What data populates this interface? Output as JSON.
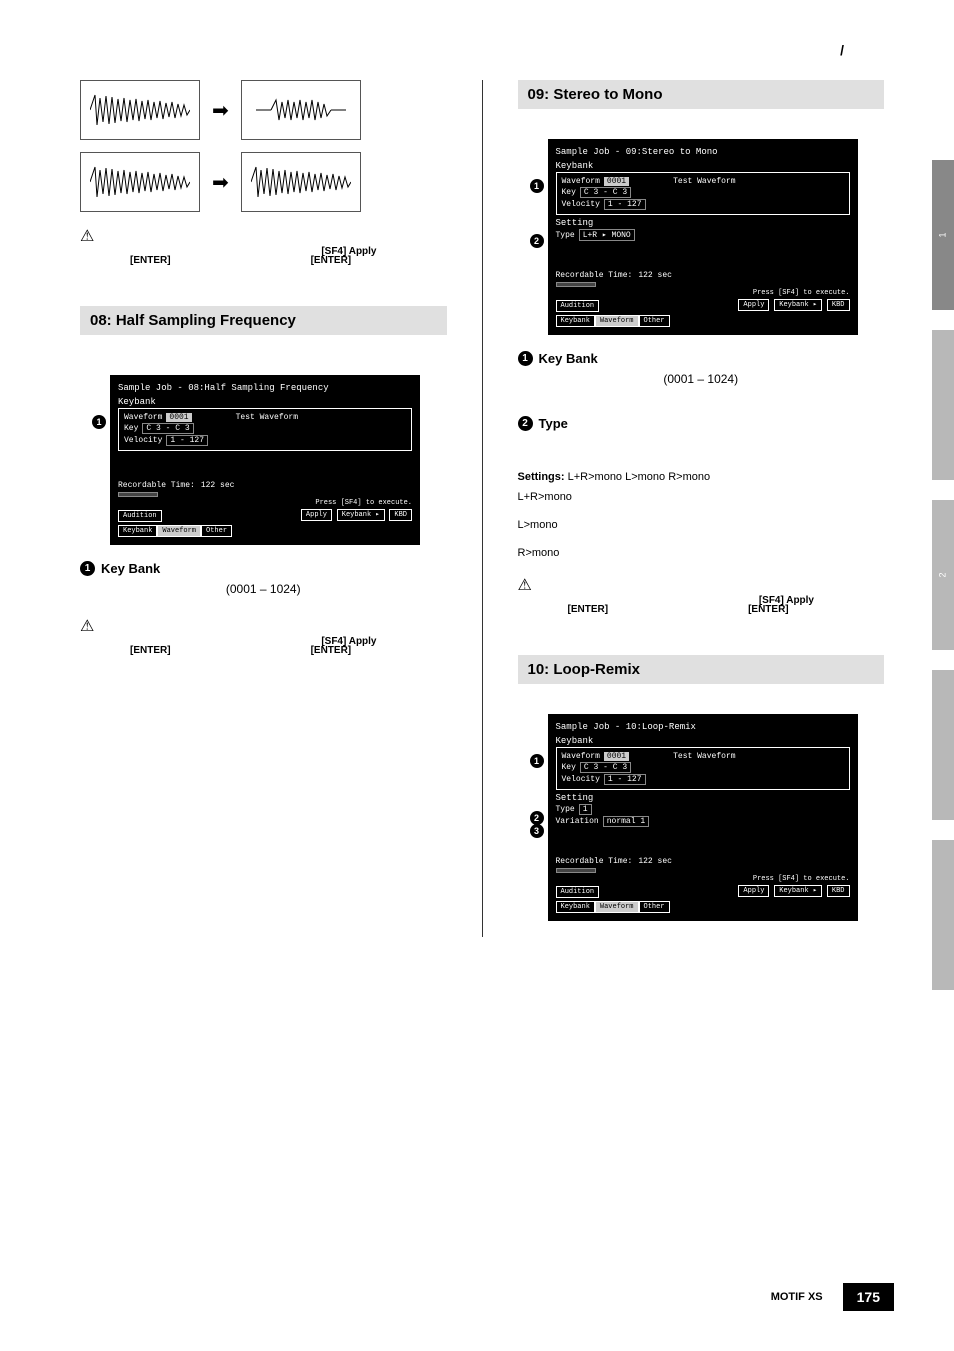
{
  "slash": "/",
  "sections": {
    "s08": {
      "title": "08: Half Sampling Frequency"
    },
    "s09": {
      "title": "09: Stereo to Mono"
    },
    "s10": {
      "title": "10: Loop-Remix"
    }
  },
  "sf4_apply": "[SF4] Apply",
  "enter": "[ENTER]",
  "keybank": {
    "label": "Key Bank",
    "range": "(0001 – 1024)"
  },
  "type": {
    "label": "Type",
    "settings_label": "Settings:",
    "settings_values": "L+R>mono   L>mono   R>mono",
    "opt1": "L+R>mono",
    "opt2": "L>mono",
    "opt3": "R>mono"
  },
  "lcd08": {
    "title": "Sample Job - 08:Half Sampling Frequency",
    "keybank": "Keybank",
    "waveform": "Waveform",
    "waveform_val": "0001",
    "test": "Test Waveform",
    "key": "Key",
    "key_val": "C 3 - C 3",
    "velocity": "Velocity",
    "velocity_val": "1 - 127",
    "rec_time": "Recordable Time:",
    "rec_val": "122 sec",
    "press": "Press [SF4] to execute.",
    "audition": "Audition",
    "apply": "Apply",
    "keybank_btn": "Keybank ▸",
    "kbd": "KBD",
    "tab1": "Keybank",
    "tab2": "Waveform",
    "tab3": "Other"
  },
  "lcd09": {
    "title": "Sample Job - 09:Stereo to Mono",
    "keybank": "Keybank",
    "waveform": "Waveform",
    "waveform_val": "0001",
    "test": "Test Waveform",
    "key": "Key",
    "key_val": "C 3 - C 3",
    "velocity": "Velocity",
    "velocity_val": "1 - 127",
    "setting": "Setting",
    "type": "Type",
    "type_val": "L+R ▸ MONO",
    "rec_time": "Recordable Time:",
    "rec_val": "122 sec",
    "press": "Press [SF4] to execute.",
    "audition": "Audition",
    "apply": "Apply",
    "keybank_btn": "Keybank ▸",
    "kbd": "KBD",
    "tab1": "Keybank",
    "tab2": "Waveform",
    "tab3": "Other"
  },
  "lcd10": {
    "title": "Sample Job - 10:Loop-Remix",
    "keybank": "Keybank",
    "waveform": "Waveform",
    "waveform_val": "0001",
    "test": "Test Waveform",
    "key": "Key",
    "key_val": "C 3 - C 3",
    "velocity": "Velocity",
    "velocity_val": "1 - 127",
    "setting": "Setting",
    "type": "Type",
    "type_val": "1",
    "variation": "Variation",
    "variation_val": "normal 1",
    "rec_time": "Recordable Time:",
    "rec_val": "122 sec",
    "press": "Press [SF4] to execute.",
    "audition": "Audition",
    "apply": "Apply",
    "keybank_btn": "Keybank ▸",
    "kbd": "KBD",
    "tab1": "Keybank",
    "tab2": "Waveform",
    "tab3": "Other"
  },
  "side_tabs": {
    "t1": "1",
    "t2": "2"
  },
  "footer": {
    "product": "MOTIF XS",
    "page": "175"
  }
}
